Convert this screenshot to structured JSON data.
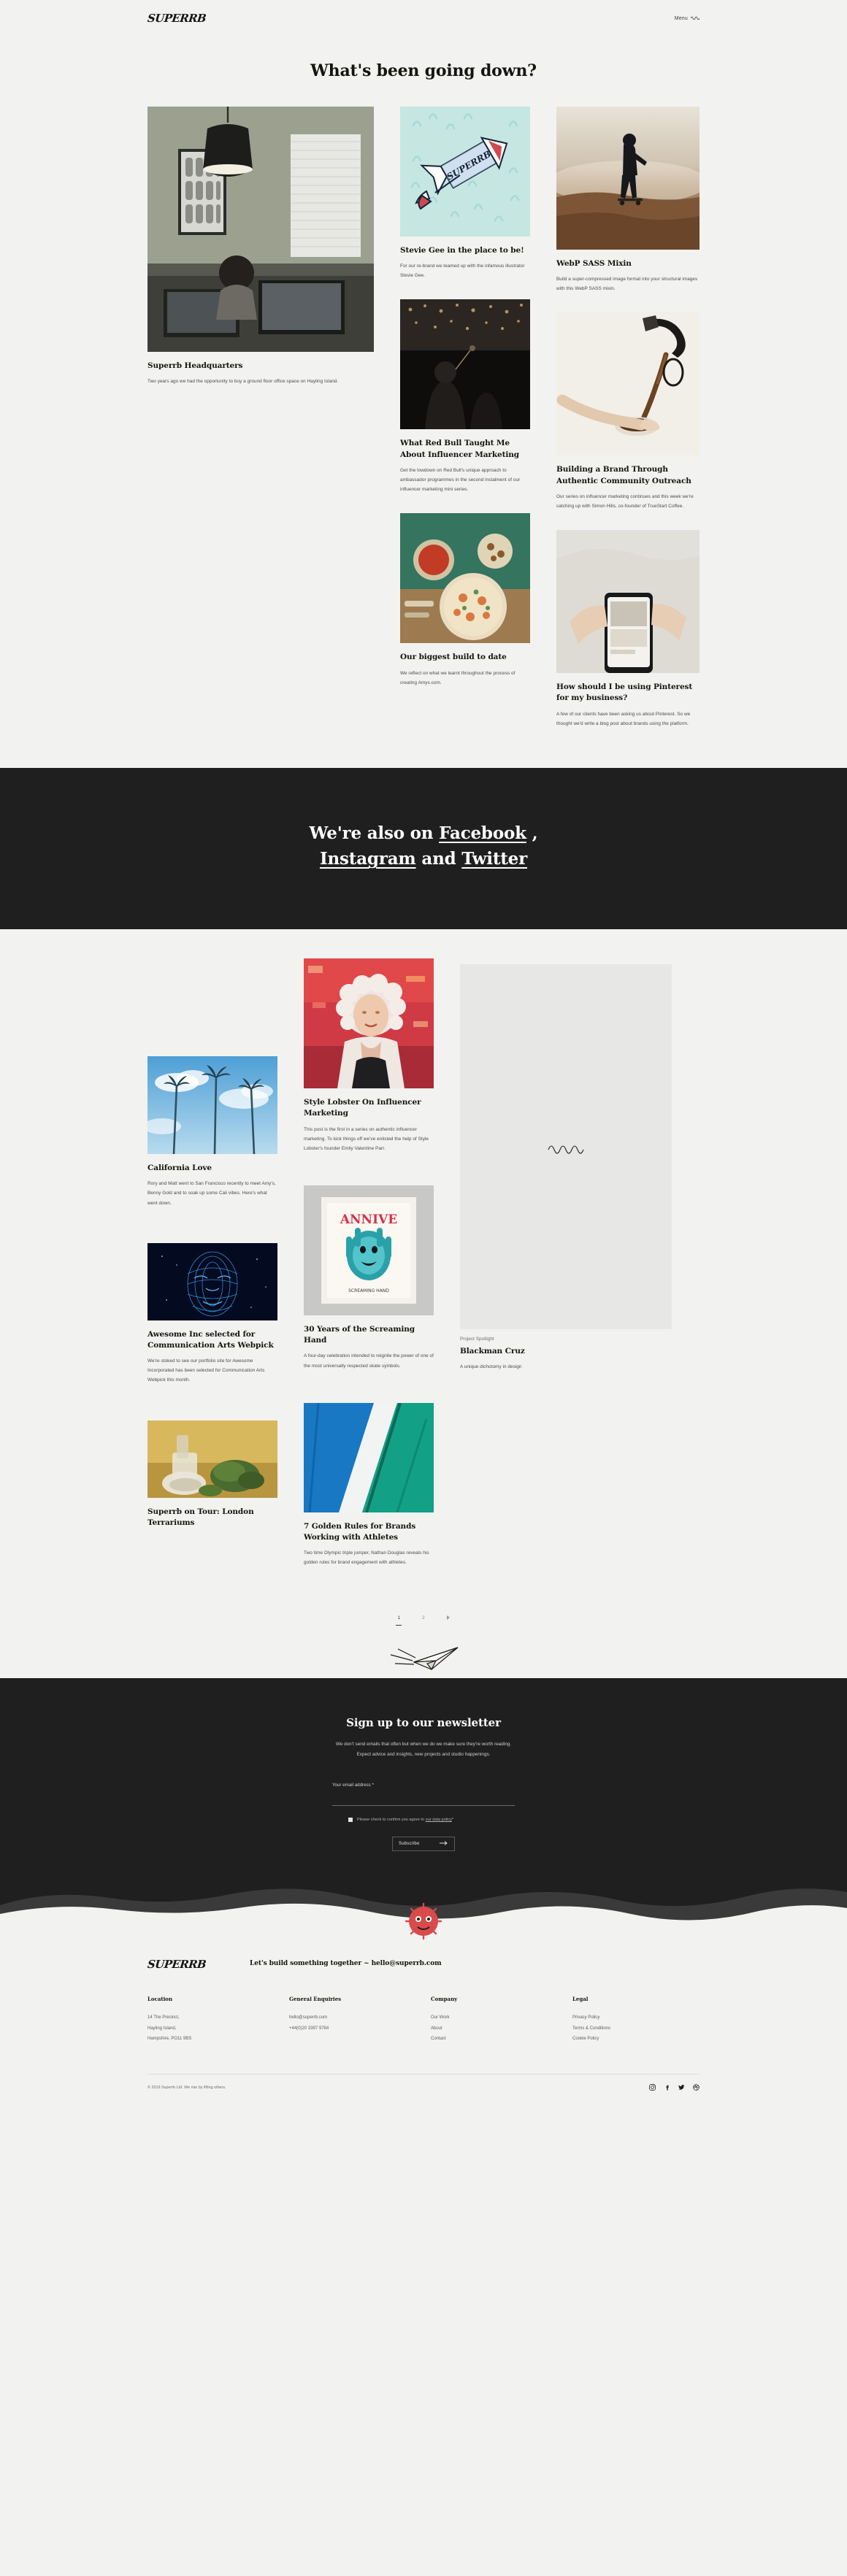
{
  "header": {
    "logo": "SUPERRB",
    "menu_label": "Menu"
  },
  "page": {
    "title": "What's been going down?"
  },
  "grid1": {
    "col1": [
      {
        "title": "Superrb Headquarters",
        "excerpt": "Two years ago we had the opportunity to buy a ground floor office space on Hayling Island.",
        "image_name": "office-interior-photo"
      }
    ],
    "col2": [
      {
        "title": "Stevie Gee in the place to be!",
        "excerpt": "For our re-brand we teamed up with the infamous illustrator Stevie Gee.",
        "image_name": "rocket-illustration"
      },
      {
        "title": "What Red Bull Taught Me About Influencer Marketing",
        "excerpt": "Get the lowdown on Red Bull's unique approach to ambassador programmes in the second instalment of our influencer marketing mini series.",
        "image_name": "concert-crowd-photo"
      },
      {
        "title": "Our biggest build to date",
        "excerpt": "We reflect on what we learnt throughout the process of creating Amys.com.",
        "image_name": "food-table-photo"
      }
    ],
    "col3": [
      {
        "title": "WebP SASS Mixin",
        "excerpt": "Build a super-compressed image format into your structural images with this WebP SASS mixin.",
        "image_name": "desert-skater-photo"
      },
      {
        "title": "Building a Brand Through Authentic Community Outreach",
        "excerpt": "Our series on influencer marketing continues and this week we're catching up with Simon Hills, co-founder of TrueStart Coffee.",
        "image_name": "coffee-pour-photo"
      },
      {
        "title": "How should I be using Pinterest for my business?",
        "excerpt": "A few of our clients have been asking us about Pinterest. So we thought we'd write a blog post about brands using the platform.",
        "image_name": "phone-in-hands-photo"
      }
    ]
  },
  "social_band": {
    "lead": "We're also on ",
    "facebook": "Facebook",
    "comma": " ,",
    "instagram": "Instagram",
    "and": " and ",
    "twitter": "Twitter"
  },
  "grid2": {
    "col1": [
      {
        "title": "California Love",
        "excerpt": "Rory and Matt went to San Francisco recently to meet Amy's, Benny Gold and to soak up some Cali vibes. Here's what went down.",
        "image_name": "palm-trees-sky-photo"
      },
      {
        "title": "Awesome Inc selected for Communication Arts Webpick",
        "excerpt": "We're stoked to see our portfolio site for Awesome Incorporated has been selected for Communication Arts Webpick this month.",
        "image_name": "blue-face-wireframe-photo"
      },
      {
        "title": "Superrb on Tour: London Terrariums",
        "excerpt": "",
        "image_name": "terrarium-moss-photo"
      }
    ],
    "col2": [
      {
        "title": "Style Lobster On Influencer Marketing",
        "excerpt": "This post is the first in a series on authentic influencer marketing. To kick things off we've enlisted the help of Style Lobster's founder Emily Valentine Parr.",
        "image_name": "woman-portrait-photo"
      },
      {
        "title": "30 Years of the Screaming Hand",
        "excerpt": "A four-day celebration intended to reignite the power of one of the most universally respected skate symbols.",
        "image_name": "screaming-hand-poster"
      },
      {
        "title": "7 Golden Rules for Brands Working with Athletes",
        "excerpt": "Two time Olympic triple jumper, Nathan Douglas reveals his golden rules for brand engagement with athletes.",
        "image_name": "tennis-court-abstract-photo"
      }
    ],
    "col3": [
      {
        "kicker": "Project Spotlight",
        "title": "Blackman Cruz",
        "excerpt": "A unique dichotomy in design",
        "image_name": "blackman-cruz-project-tile"
      }
    ]
  },
  "pagination": {
    "pages": [
      "1",
      "2"
    ],
    "active": "1",
    "next_icon": "chevron-right-icon"
  },
  "newsletter": {
    "title": "Sign up to our newsletter",
    "blurb_line1": "We don't send emails that often but when we do we make sure they're worth reading.",
    "blurb_line2": "Expect advice and insights, new projects and studio happenings.",
    "email_label": "Your email address *",
    "email_placeholder": "",
    "email_value": "",
    "consent_text": "Please check to confirm you agree to ",
    "consent_link": "our data policy",
    "consent_suffix": "*",
    "submit_label": "Subscribe"
  },
  "footer": {
    "logo": "SUPERRB",
    "tagline": "Let's build something together ~ hello@superrb.com",
    "columns": [
      {
        "title": "Location",
        "items": [
          "14 The Precinct,",
          "Hayling Island,",
          "Hampshire, PO11 9BS"
        ]
      },
      {
        "title": "General Enquiries",
        "items": [
          "hello@superrb.com",
          "+44(0)20 3397 9784"
        ]
      },
      {
        "title": "Company",
        "items": [
          "Our Work",
          "About",
          "Contact"
        ]
      },
      {
        "title": "Legal",
        "items": [
          "Privacy Policy",
          "Terms & Conditions",
          "Cookie Policy"
        ]
      }
    ],
    "copyright": "© 2019 Superrb Ltd. We rise by lifting others.",
    "social": [
      "instagram-icon",
      "facebook-icon",
      "twitter-icon",
      "dribbble-icon"
    ]
  },
  "colors": {
    "page_bg": "#f2f2f0",
    "dark_bg": "#1f1f1f",
    "text": "#15150f",
    "muted": "#5c5c5c"
  }
}
